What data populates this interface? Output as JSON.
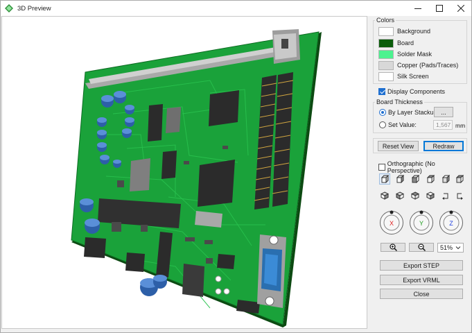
{
  "window": {
    "title": "3D Preview"
  },
  "colors": {
    "legend": "Colors",
    "items": [
      {
        "label": "Background",
        "color": "#ffffff"
      },
      {
        "label": "Board",
        "color": "#0a5c0a"
      },
      {
        "label": "Solder Mask",
        "color": "#4cf28f"
      },
      {
        "label": "Copper (Pads/Traces)",
        "color": "#d8d8d8"
      },
      {
        "label": "Silk Screen",
        "color": "#ffffff"
      }
    ]
  },
  "display_components": {
    "label": "Display Components",
    "checked": true
  },
  "board_thickness": {
    "legend": "Board Thickness",
    "by_layer_label": "By Layer Stackup",
    "by_layer_button": "...",
    "set_value_label": "Set Value:",
    "value": "1,567",
    "unit": "mm",
    "selected": "By Layer Stackup"
  },
  "actions": {
    "reset_view": "Reset View",
    "redraw": "Redraw"
  },
  "orthographic": {
    "label": "Orthographic (No Perspective)",
    "checked": false
  },
  "view_icons": [
    "view-front-icon",
    "view-back-icon",
    "view-left-icon",
    "view-right-icon",
    "view-top-icon",
    "view-bottom-icon",
    "view-iso1-icon",
    "view-iso2-icon",
    "view-iso3-icon",
    "view-iso4-icon",
    "rotate-left-icon",
    "rotate-right-icon"
  ],
  "axes": [
    {
      "label": "X",
      "color": "#e02020"
    },
    {
      "label": "Y",
      "color": "#1a9a1a"
    },
    {
      "label": "Z",
      "color": "#2040e0"
    }
  ],
  "zoom": {
    "value": "51%"
  },
  "bottom_buttons": {
    "export_step": "Export STEP",
    "export_vrml": "Export VRML",
    "close": "Close"
  }
}
